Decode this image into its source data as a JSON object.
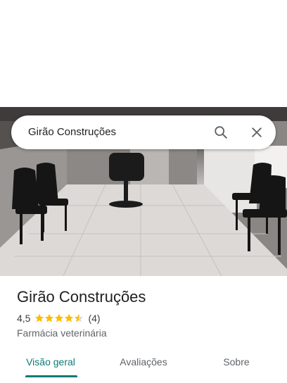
{
  "search": {
    "query": "Girão Construções"
  },
  "icons": {
    "search": "search-icon",
    "close": "close-icon",
    "star": "star-icon"
  },
  "place": {
    "name": "Girão Construções",
    "rating": "4,5",
    "stars": 4.5,
    "review_count": "(4)",
    "category": "Farmácia veterinária"
  },
  "tabs": [
    {
      "label": "Visão geral",
      "active": true
    },
    {
      "label": "Avaliações",
      "active": false
    },
    {
      "label": "Sobre",
      "active": false
    }
  ],
  "colors": {
    "accent": "#0b7a75",
    "star": "#fbbc04"
  }
}
